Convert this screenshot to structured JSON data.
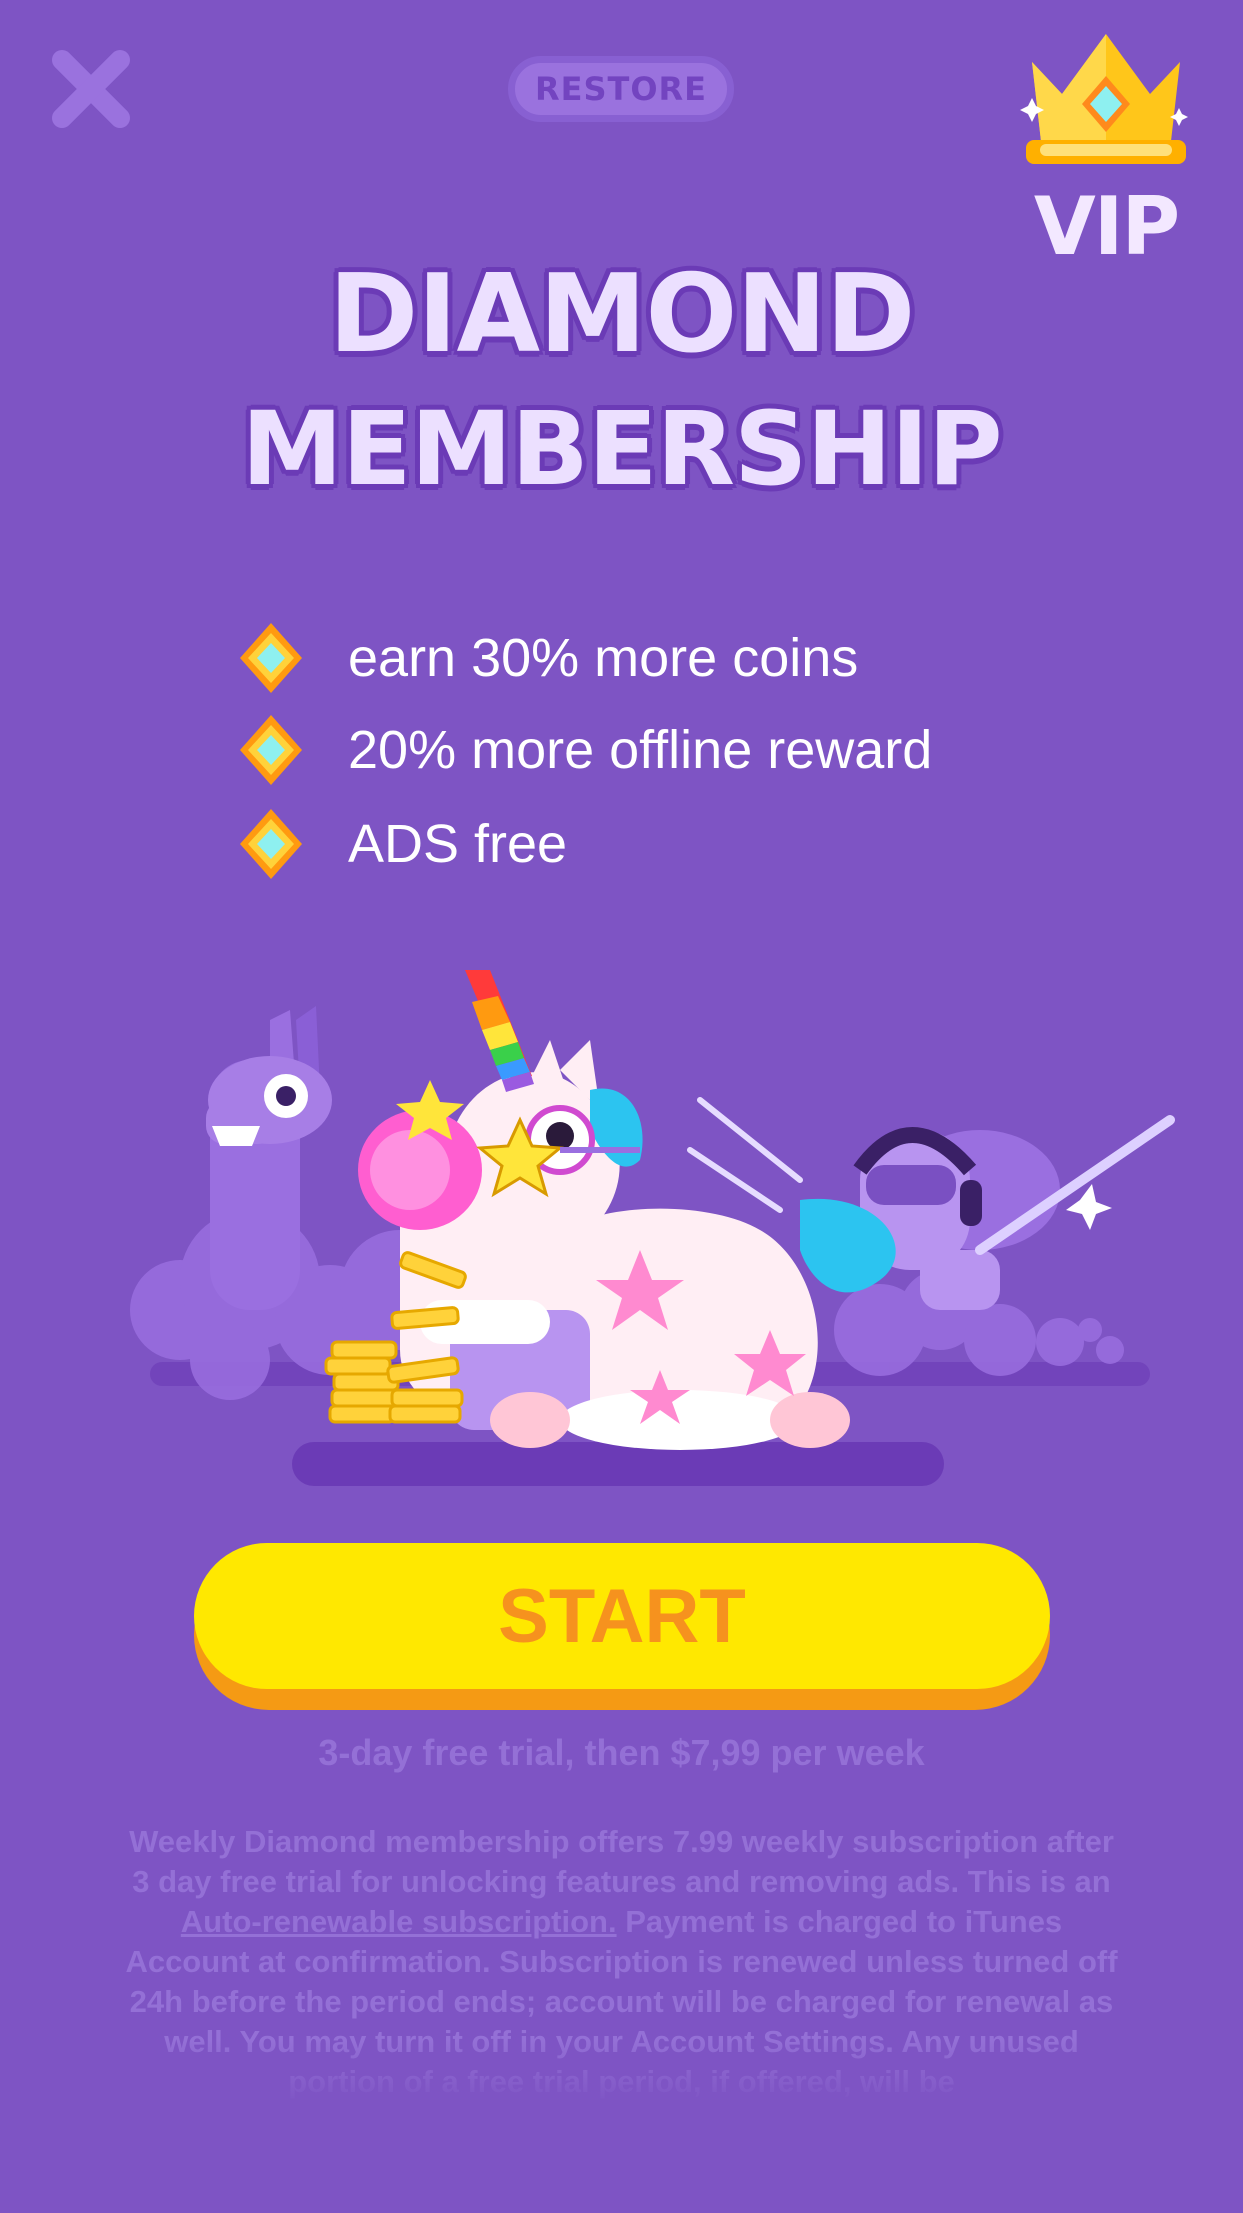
{
  "header": {
    "restore_label": "RESTORE",
    "vip_label": "VIP"
  },
  "title": {
    "line1": "DIAMOND",
    "line2": "MEMBERSHIP"
  },
  "features": [
    {
      "icon": "diamond-icon",
      "text": "earn 30% more coins"
    },
    {
      "icon": "diamond-icon",
      "text": "20% more offline reward"
    },
    {
      "icon": "diamond-icon",
      "text": "ADS free"
    }
  ],
  "cta": {
    "start_label": "START",
    "trial_text": "3-day free trial, then $7,99 per week"
  },
  "legal": {
    "before_link": "Weekly Diamond membership offers 7.99 weekly subscription after 3 day free trial for unlocking features and removing ads. This is an ",
    "link_text": "Auto-renewable subscription.",
    "after_link": " Payment is charged to iTunes Account at confirmation. Subscription is renewed unless turned off 24h before the period ends; account will be charged for renewal as well. You may turn it off in your Account Settings. Any unused portion of a free trial period, if offered, will be"
  },
  "colors": {
    "background": "#7e54c4",
    "start_button": "#ffe800",
    "start_text": "#f6921e",
    "muted_text": "#9470d6"
  }
}
